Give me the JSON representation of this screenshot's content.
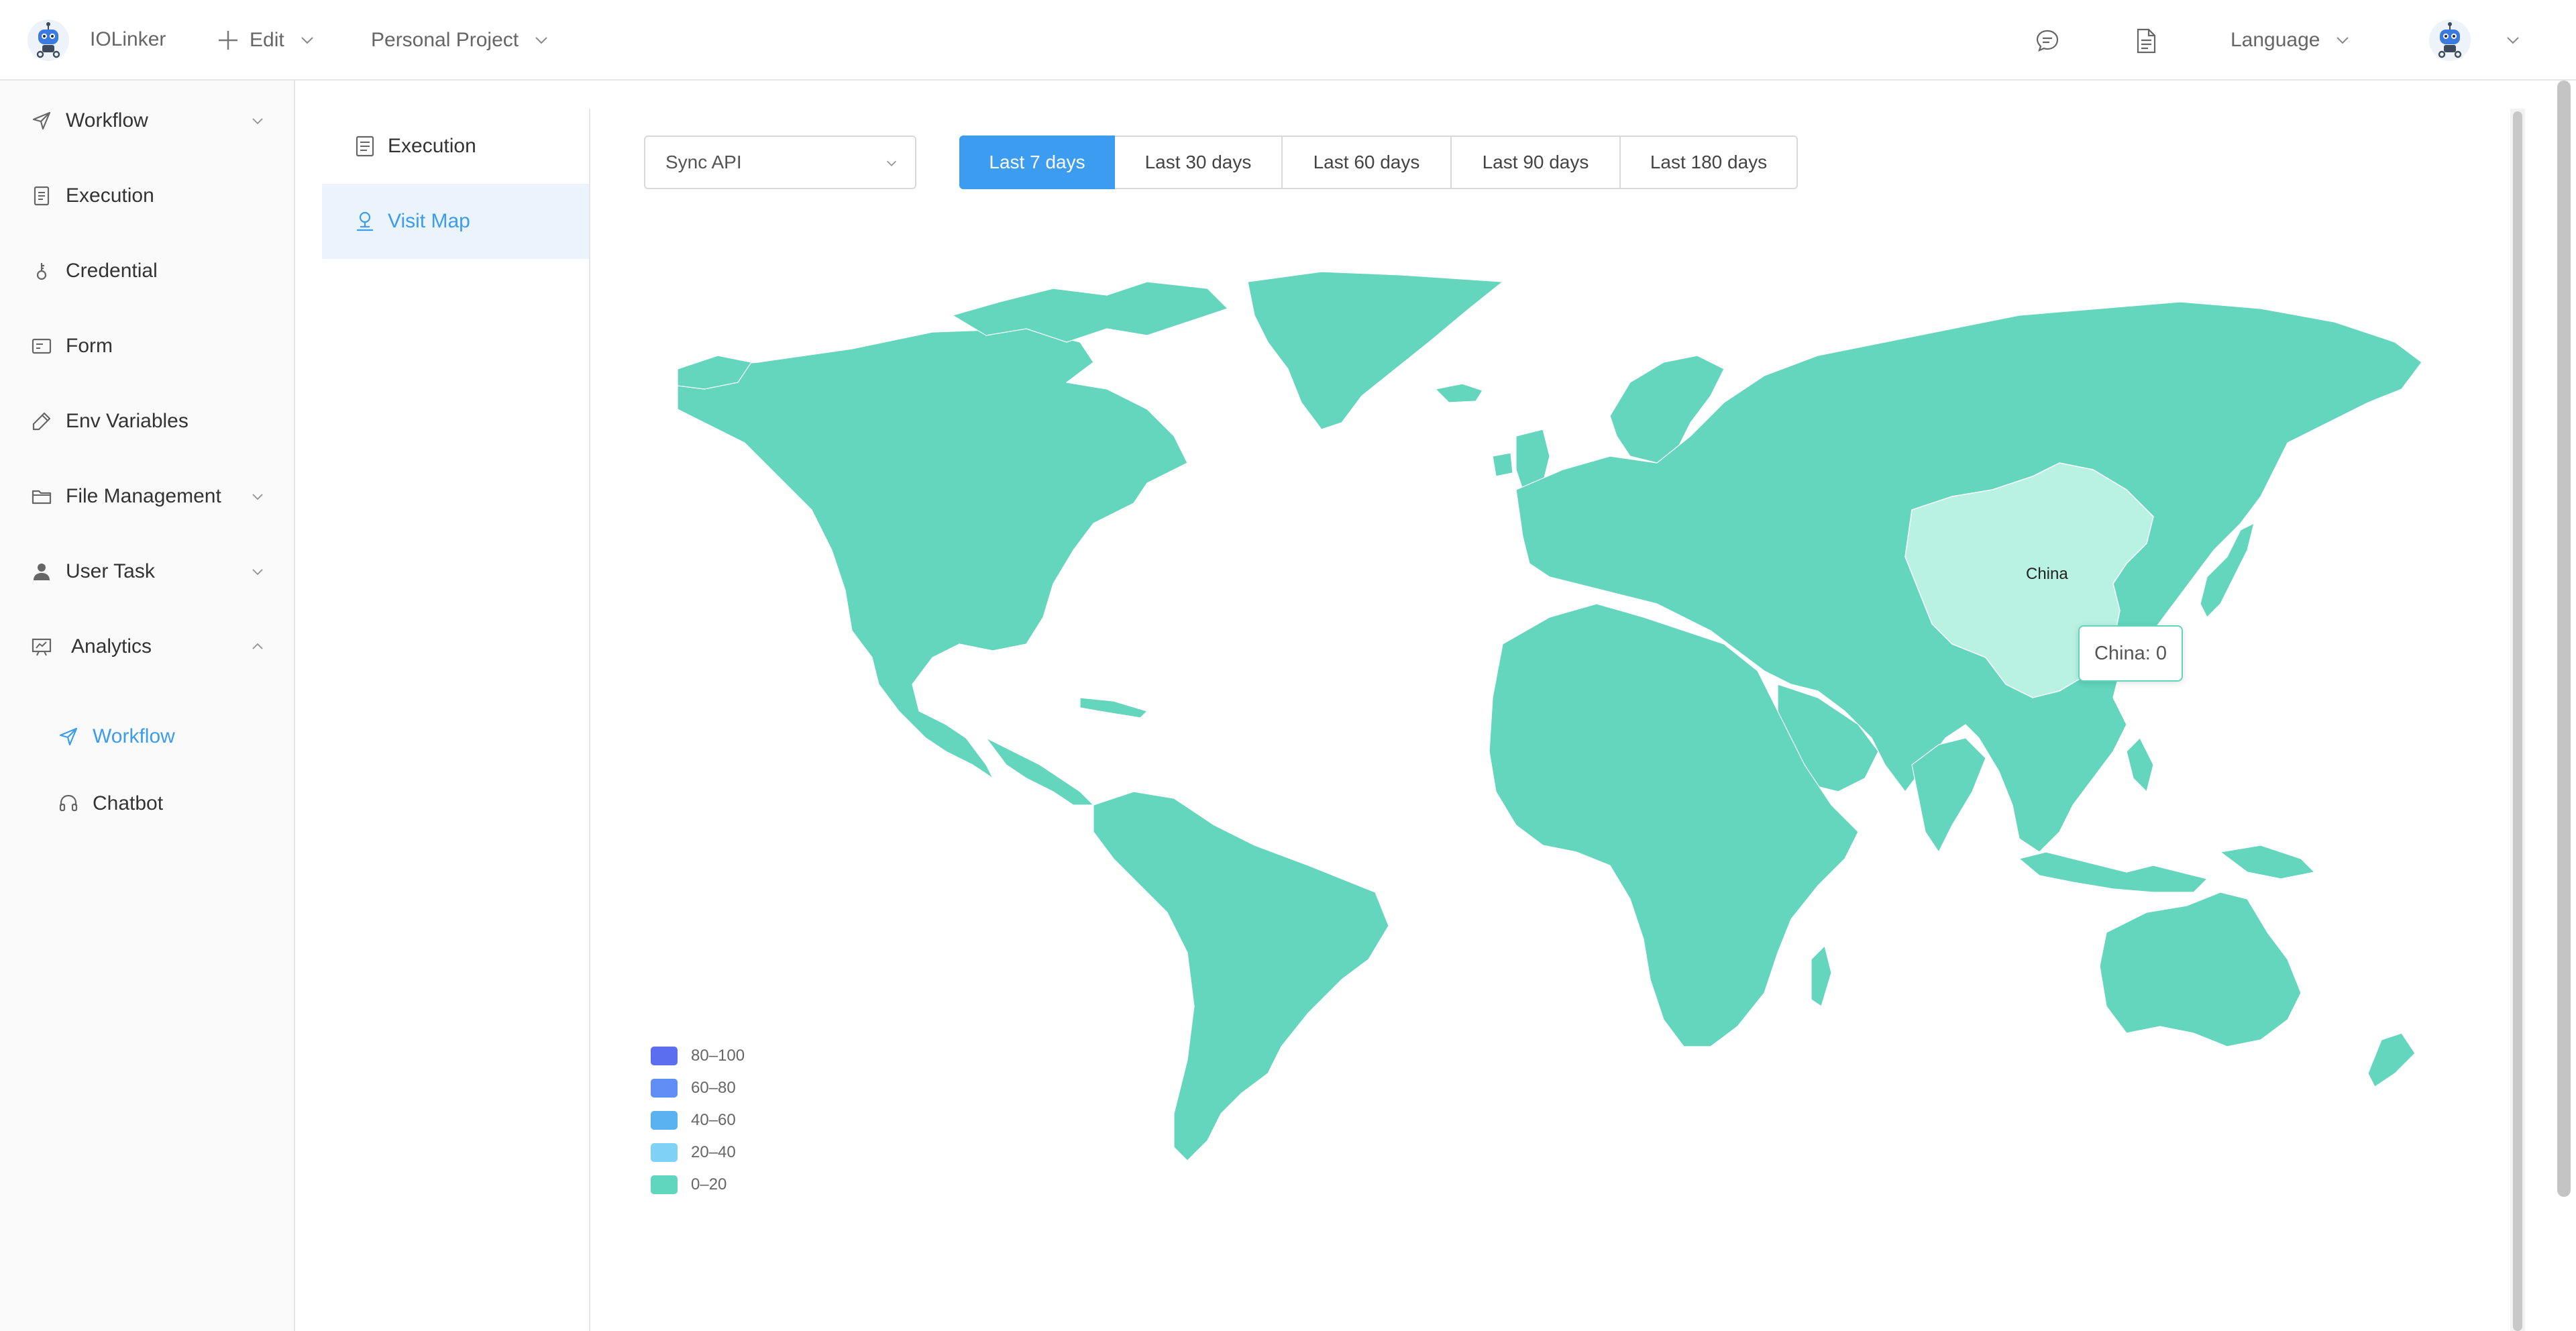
{
  "app": {
    "name": "IOLinker",
    "edit_label": "Edit",
    "project_label": "Personal Project",
    "language_label": "Language"
  },
  "sidebar": {
    "items": [
      {
        "label": "Workflow",
        "icon": "send-icon",
        "expandable": true,
        "expanded": false
      },
      {
        "label": "Execution",
        "icon": "document-icon"
      },
      {
        "label": "Credential",
        "icon": "key-icon"
      },
      {
        "label": "Form",
        "icon": "form-icon"
      },
      {
        "label": "Env Variables",
        "icon": "pencil-icon"
      },
      {
        "label": "File Management",
        "icon": "folder-icon",
        "expandable": true,
        "expanded": false
      },
      {
        "label": "User Task",
        "icon": "user-icon",
        "expandable": true,
        "expanded": false
      },
      {
        "label": "Analytics",
        "icon": "presentation-icon",
        "expandable": true,
        "expanded": true
      }
    ],
    "analytics_sub": [
      {
        "label": "Workflow",
        "icon": "send-icon",
        "active": true
      },
      {
        "label": "Chatbot",
        "icon": "headset-icon",
        "active": false
      }
    ]
  },
  "subnav": {
    "items": [
      {
        "label": "Execution",
        "icon": "document-icon",
        "active": false
      },
      {
        "label": "Visit Map",
        "icon": "map-pin-icon",
        "active": true
      }
    ]
  },
  "filters": {
    "api_select": "Sync API",
    "ranges": [
      "Last 7 days",
      "Last 30 days",
      "Last 60 days",
      "Last 90 days",
      "Last 180 days"
    ],
    "active_range": "Last 7 days"
  },
  "map": {
    "highlight_label": "China",
    "tooltip": "China: 0",
    "legend": [
      {
        "label": "80–100",
        "color": "#5b6ef0"
      },
      {
        "label": "60–80",
        "color": "#5f8ff4"
      },
      {
        "label": "40–60",
        "color": "#5bb2f0"
      },
      {
        "label": "20–40",
        "color": "#7fd2f6"
      },
      {
        "label": "0–20",
        "color": "#5fd6bd"
      }
    ],
    "land_color": "#63d6bd",
    "highlight_color": "#b9f1e3"
  },
  "colors": {
    "accent": "#3b9cf0",
    "sidebar_bg": "#fafafa",
    "active_bg": "#ebf4fd"
  }
}
